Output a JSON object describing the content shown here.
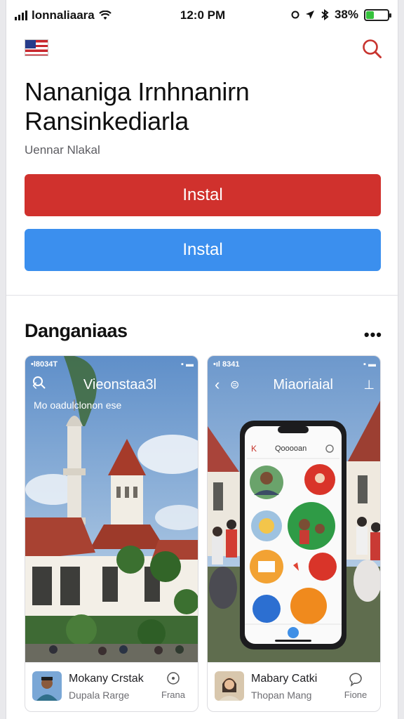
{
  "status_bar": {
    "carrier": "lonnaliaara",
    "time": "12:0 PM",
    "battery": "38%",
    "battery_level": 0.38
  },
  "header": {
    "flag_icon": "us-flag-icon",
    "search_icon": "search-icon"
  },
  "app": {
    "title_line1": "Nananiga Irnhnanirn",
    "title_line2": "Ransinkediarla",
    "subtitle": "Uennar Nlakal"
  },
  "buttons": {
    "primary_label": "Instal",
    "secondary_label": "Instal"
  },
  "colors": {
    "primary": "#d0312d",
    "secondary": "#3b8fee"
  },
  "section": {
    "title": "Danganiaas",
    "more": "•••"
  },
  "screenshots": [
    {
      "status_time": "•l8034T",
      "nav_title": "Vieonstaa3l",
      "caption": "Mo oadulclonon ese",
      "developer": "Mokany Crstak",
      "developer_sub": "Dupala Rarge",
      "action_label": "Frana",
      "action_icon": "location-pin-icon"
    },
    {
      "status_time": "•ıl 8341",
      "nav_title": "Miaoriaial",
      "developer": "Mabary Catki",
      "developer_sub": "Thopan Mang",
      "action_label": "Fione",
      "action_icon": "chat-bubble-icon",
      "phone_search": "Qooooan"
    }
  ]
}
